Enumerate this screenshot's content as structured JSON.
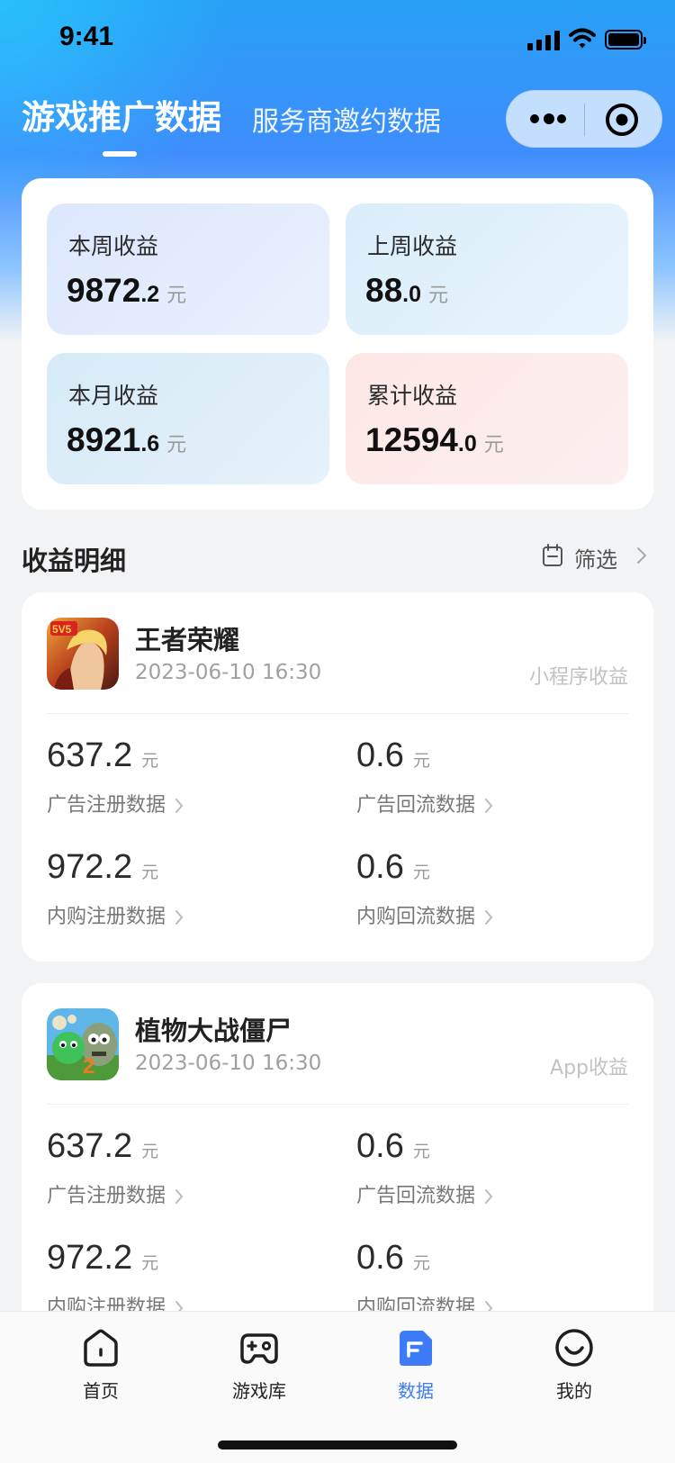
{
  "status": {
    "time": "9:41"
  },
  "header": {
    "tabs": [
      {
        "label": "游戏推广数据"
      },
      {
        "label": "服务商邀约数据"
      }
    ]
  },
  "summary": [
    {
      "label": "本周收益",
      "int": "9872",
      "dec": ".2",
      "unit": "元"
    },
    {
      "label": "上周收益",
      "int": "88",
      "dec": ".0",
      "unit": "元"
    },
    {
      "label": "本月收益",
      "int": "8921",
      "dec": ".6",
      "unit": "元"
    },
    {
      "label": "累计收益",
      "int": "12594",
      "dec": ".0",
      "unit": "元"
    }
  ],
  "details": {
    "title": "收益明细",
    "filter_label": "筛选"
  },
  "cards": [
    {
      "name": "王者荣耀",
      "date": "2023-06-10 16:30",
      "source": "小程序收益",
      "icon": "honor-of-kings-icon",
      "metrics": [
        {
          "value": "637.2",
          "unit": "元",
          "label": "广告注册数据"
        },
        {
          "value": "0.6",
          "unit": "元",
          "label": "广告回流数据"
        },
        {
          "value": "972.2",
          "unit": "元",
          "label": "内购注册数据"
        },
        {
          "value": "0.6",
          "unit": "元",
          "label": "内购回流数据"
        }
      ]
    },
    {
      "name": "植物大战僵尸",
      "date": "2023-06-10 16:30",
      "source": "App收益",
      "icon": "plants-vs-zombies-icon",
      "metrics": [
        {
          "value": "637.2",
          "unit": "元",
          "label": "广告注册数据"
        },
        {
          "value": "0.6",
          "unit": "元",
          "label": "广告回流数据"
        },
        {
          "value": "972.2",
          "unit": "元",
          "label": "内购注册数据"
        },
        {
          "value": "0.6",
          "unit": "元",
          "label": "内购回流数据"
        }
      ]
    }
  ],
  "tabbar": [
    {
      "label": "首页",
      "icon": "home-icon"
    },
    {
      "label": "游戏库",
      "icon": "gamepad-icon"
    },
    {
      "label": "数据",
      "icon": "data-icon",
      "active": true
    },
    {
      "label": "我的",
      "icon": "profile-icon"
    }
  ],
  "colors": {
    "accent": "#3d7bf7",
    "header_top": "#27a0f6"
  }
}
